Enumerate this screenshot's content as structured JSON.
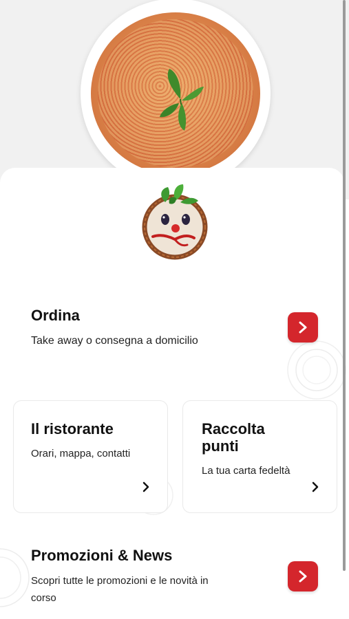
{
  "brand_color": "#d4262c",
  "icons": {
    "hero": "pizza-photo",
    "logo": "pizza-face-logo",
    "arrow": "chevron-right-icon"
  },
  "order": {
    "title": "Ordina",
    "subtitle": "Take away o consegna a domicilio"
  },
  "restaurant": {
    "title": "Il ristorante",
    "subtitle": "Orari, mappa, contatti"
  },
  "loyalty": {
    "title_line1": "Raccolta",
    "title_line2": "punti",
    "subtitle": "La tua carta fedeltà"
  },
  "promo": {
    "title": "Promozioni & News",
    "subtitle_line1": "Scopri tutte le promozioni e le novità in",
    "subtitle_line2": "corso"
  }
}
